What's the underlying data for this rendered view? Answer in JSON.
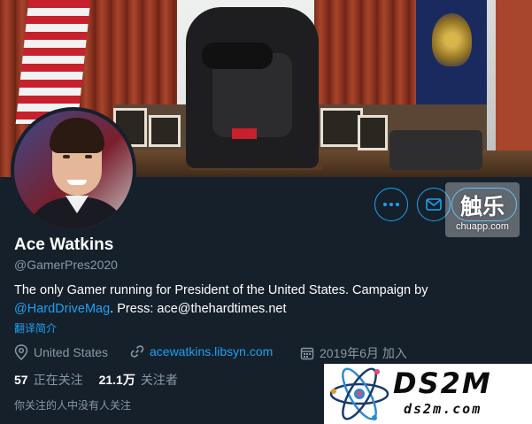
{
  "profile": {
    "name": "Ace Watkins",
    "handle": "@GamerPres2020",
    "bio_text": "The only Gamer running for President of the United States. Campaign by ",
    "bio_mention": "@HardDriveMag",
    "bio_tail": ". Press: ace@thehardtimes.net",
    "translate_label": "翻译简介",
    "location": "United States",
    "website": "acewatkins.libsyn.com",
    "joined": "2019年6月 加入",
    "following_count": "57",
    "following_label": "正在关注",
    "followers_count": "21.1万",
    "followers_label": "关注者",
    "followed_by_note": "你关注的人中没有人关注"
  },
  "actions": {
    "more_icon": "ellipsis-icon",
    "message_icon": "envelope-icon"
  },
  "watermarks": {
    "chuapp_big": "触乐",
    "chuapp_small": "chuapp.com",
    "ds2m_big": "DS2M",
    "ds2m_small": "ds2m.com"
  },
  "colors": {
    "background": "#15202b",
    "accent": "#1da1f2",
    "muted": "#8899a6"
  }
}
